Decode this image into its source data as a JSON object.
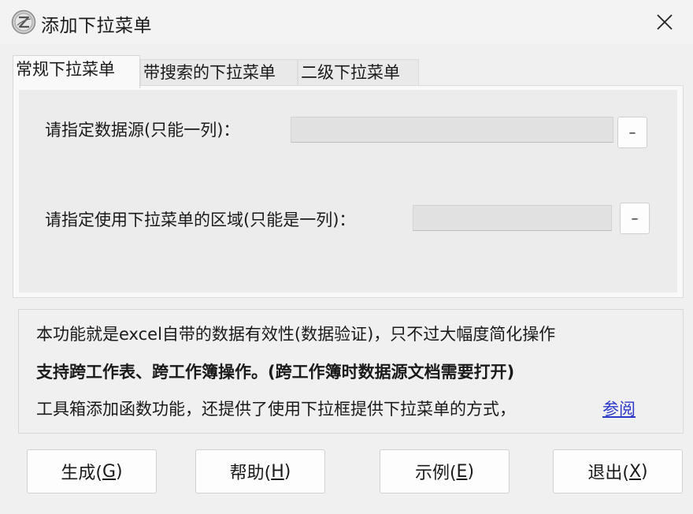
{
  "window": {
    "title": "添加下拉菜单",
    "close_glyph": "✕"
  },
  "tabs": [
    {
      "label": "常规下拉菜单",
      "active": true
    },
    {
      "label": "带搜索的下拉菜单",
      "active": false
    },
    {
      "label": "二级下拉菜单",
      "active": false
    }
  ],
  "form": {
    "source_label": "请指定数据源(只能一列)：",
    "source_value": "",
    "source_pick_glyph": "–",
    "target_label": "请指定使用下拉菜单的区域(只能是一列)：",
    "target_value": "",
    "target_pick_glyph": "–"
  },
  "info": {
    "line1": "本功能就是excel自带的数据有效性(数据验证)，只不过大幅度简化操作",
    "line2": "支持跨工作表、跨工作簿操作。(跨工作簿时数据源文档需要打开)",
    "line3": "工具箱添加函数功能，还提供了使用下拉框提供下拉菜单的方式，",
    "link": "参阅"
  },
  "buttons": {
    "generate": {
      "text": "生成(",
      "key": "G",
      "close": ")"
    },
    "help": {
      "text": "帮助(",
      "key": "H",
      "close": ")"
    },
    "example": {
      "text": "示例(",
      "key": "E",
      "close": ")"
    },
    "exit": {
      "text": "退出(",
      "key": "X",
      "close": ")"
    }
  },
  "colors": {
    "link": "#2a37c9",
    "window_bg": "#f0f0f0"
  }
}
